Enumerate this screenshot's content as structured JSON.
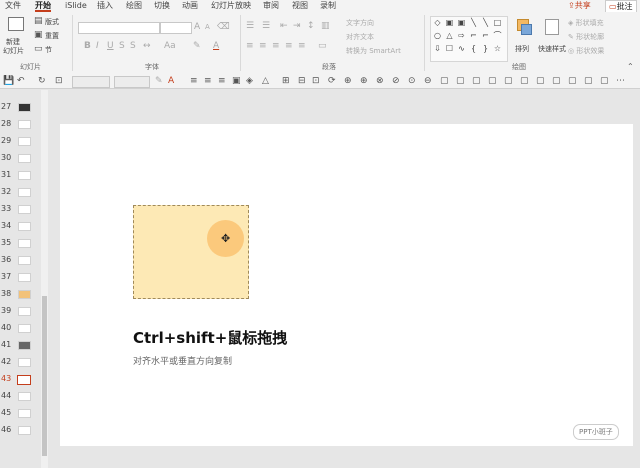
{
  "menu": {
    "items": [
      "文件",
      "开始",
      "iSlide",
      "插入",
      "绘图",
      "切换",
      "动画",
      "幻灯片放映",
      "审阅",
      "视图",
      "录制"
    ],
    "active": "开始",
    "share": "共享",
    "comment": "批注"
  },
  "ribbon": {
    "slides_group": {
      "new_slide": "新建",
      "new_slide_sub": "幻灯片",
      "layout": "版式",
      "reset": "重置",
      "section": "节",
      "label": "幻灯片"
    },
    "font_group": {
      "label": "字体",
      "bold": "B",
      "italic": "I",
      "underline": "U",
      "strike": "S",
      "font_size_grow": "A",
      "font_size_shrink": "A",
      "font_color": "A",
      "case": "Aa"
    },
    "paragraph_group": {
      "label": "段落",
      "text_direction": "文字方向",
      "align_text": "对齐文本",
      "convert_smartart": "转换为 SmartArt"
    },
    "drawing_group": {
      "label": "绘图",
      "arrange": "排列",
      "quick_styles": "快速样式",
      "shape_fill": "形状填充",
      "shape_outline": "形状轮廓",
      "shape_effects": "形状效果"
    }
  },
  "thumbnails": {
    "numbers": [
      "27",
      "28",
      "29",
      "30",
      "31",
      "32",
      "33",
      "34",
      "35",
      "36",
      "37",
      "38",
      "39",
      "40",
      "41",
      "42",
      "43",
      "44",
      "45",
      "46"
    ],
    "current": "43"
  },
  "slide": {
    "title": "Ctrl+shift+鼠标拖拽",
    "subtitle": "对齐水平或垂直方向复制",
    "watermark": "PPT小斑子"
  },
  "colors": {
    "accent": "#c43e1c",
    "shape_fill": "#fde9b5",
    "cursor_halo": "#fbc97c"
  }
}
